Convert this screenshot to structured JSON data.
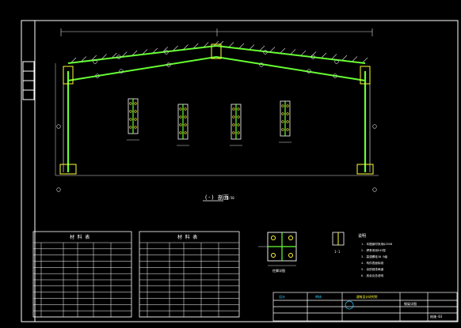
{
  "drawing": {
    "background": "#000000",
    "colors": {
      "frame": "#ffffff",
      "member": "#66ff33",
      "bolt": "#ffff33",
      "dim": "#dddddd",
      "red": "#ff3333",
      "cyan": "#33ccff"
    },
    "elevation_title": "(-) 剖面",
    "elevation_scale": "1:50"
  },
  "tables": {
    "left": {
      "title": "材 料 表",
      "rows": 12
    },
    "right": {
      "title": "材 料 表",
      "rows": 12
    }
  },
  "notes": {
    "heading": "说明",
    "lines": [
      "1. 本图钢材采用Q235B",
      "2. 焊条采用E43型",
      "3. 高强螺栓10.9级",
      "4. 构件表面除锈",
      "5. 涂防锈漆两道",
      "6. 其余见总说明"
    ]
  },
  "details": {
    "plate_label": "柱脚详图",
    "small_label": "1-1"
  },
  "title_block": {
    "company": "建筑设计研究院",
    "drawing_name": "钢架详图",
    "cell_a": "设计",
    "cell_b": "审核",
    "sheet": "结施-03"
  }
}
